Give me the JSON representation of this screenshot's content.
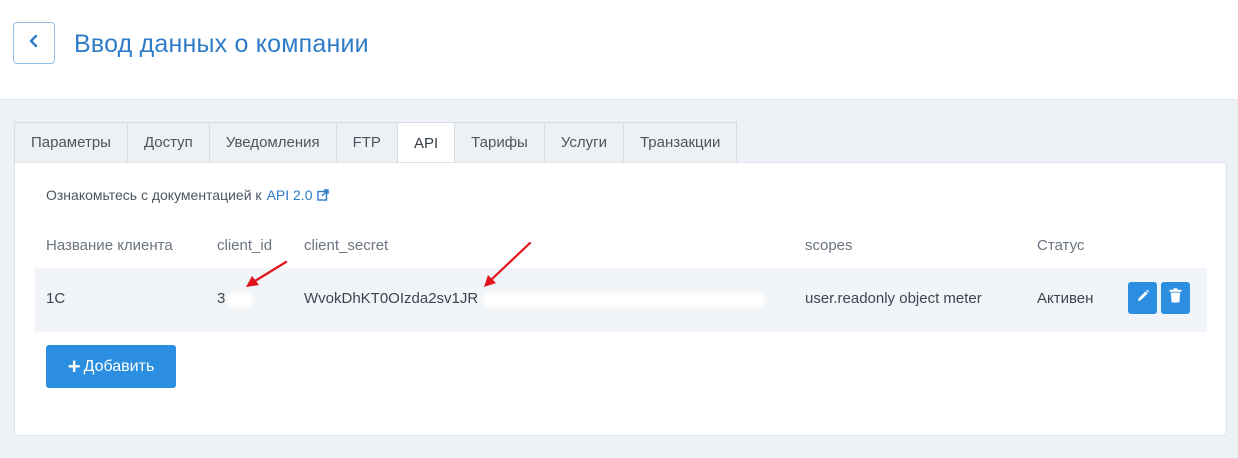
{
  "header": {
    "title": "Ввод данных о компании"
  },
  "tabs": [
    {
      "label": "Параметры",
      "active": false
    },
    {
      "label": "Доступ",
      "active": false
    },
    {
      "label": "Уведомления",
      "active": false
    },
    {
      "label": "FTP",
      "active": false
    },
    {
      "label": "API",
      "active": true
    },
    {
      "label": "Тарифы",
      "active": false
    },
    {
      "label": "Услуги",
      "active": false
    },
    {
      "label": "Транзакции",
      "active": false
    }
  ],
  "docs": {
    "text": "Ознакомьтесь с документацией к",
    "link": "API 2.0"
  },
  "table": {
    "headers": {
      "client_name": "Название клиента",
      "client_id": "client_id",
      "client_secret": "client_secret",
      "scopes": "scopes",
      "status": "Статус"
    },
    "rows": [
      {
        "client_name": "1C",
        "client_id": "3",
        "client_secret": "WvokDhKT0OIzda2sv1JR",
        "scopes": "user.readonly object meter",
        "status": "Активен"
      }
    ]
  },
  "add_button": {
    "label": "Добавить"
  },
  "colors": {
    "accent": "#2b8ee0",
    "title": "#2e7cc8",
    "annotation": "#e0141e"
  }
}
